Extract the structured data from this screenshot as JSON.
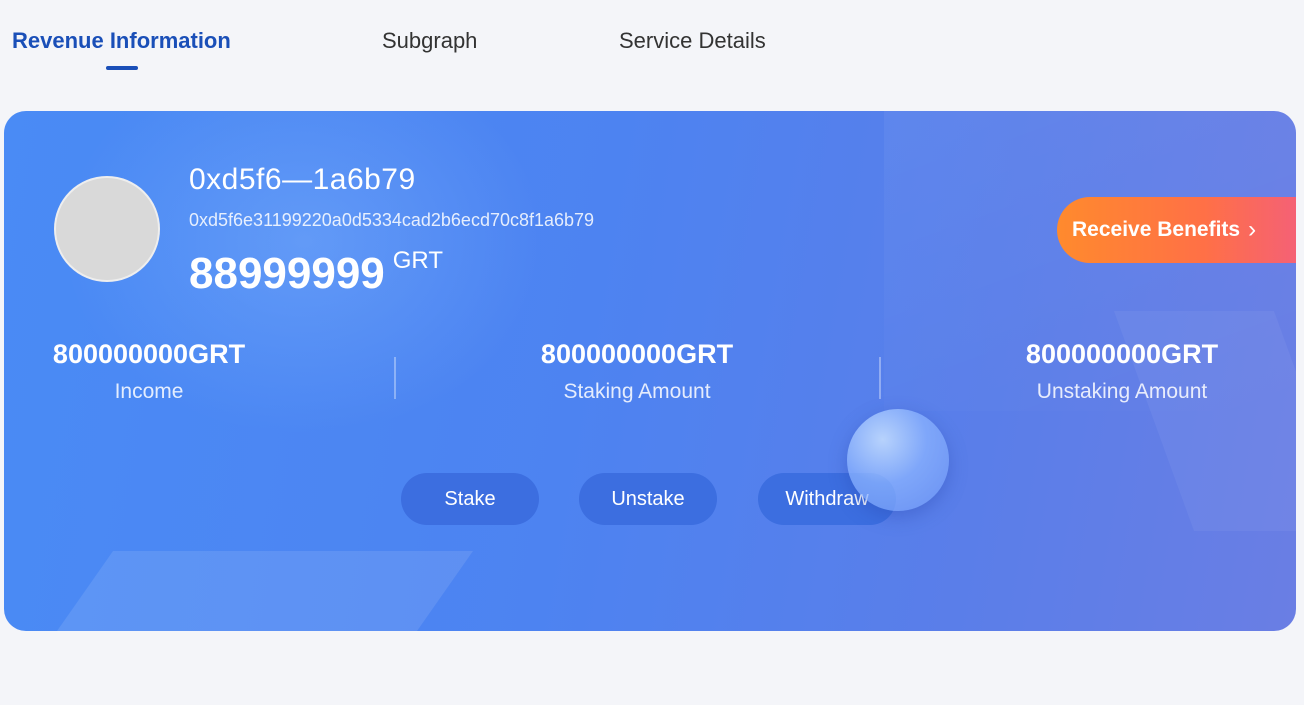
{
  "tabs": [
    {
      "label": "Revenue Information",
      "active": true
    },
    {
      "label": "Subgraph",
      "active": false
    },
    {
      "label": "Service Details",
      "active": false
    }
  ],
  "account": {
    "short_address": "0xd5f6—1a6b79",
    "full_address": "0xd5f6e31199220a0d5334cad2b6ecd70c8f1a6b79",
    "balance": "88999999",
    "balance_unit": "GRT"
  },
  "receive_button": {
    "label": "Receive Benefits",
    "icon": "chevron-right-icon",
    "chevron": "›"
  },
  "stats": [
    {
      "value": "800000000GRT",
      "label": "Income"
    },
    {
      "value": "800000000GRT",
      "label": "Staking Amount"
    },
    {
      "value": "800000000GRT",
      "label": "Unstaking Amount"
    }
  ],
  "actions": {
    "stake": "Stake",
    "unstake": "Unstake",
    "withdraw": "Withdraw"
  },
  "colors": {
    "accent": "#1a4fb8",
    "card_blue": "#4d83f1",
    "receive_orange": "#ff7046",
    "action_button": "#3c6ee0"
  }
}
